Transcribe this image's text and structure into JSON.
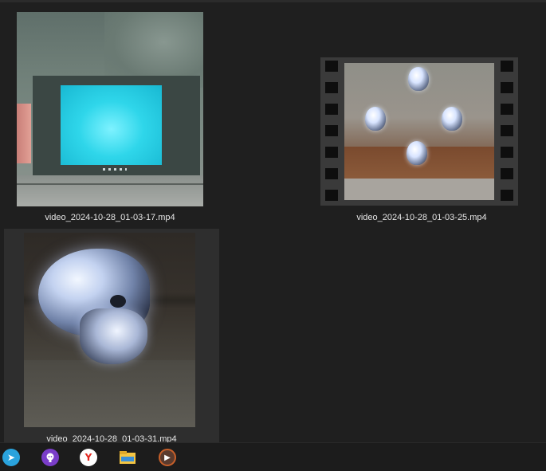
{
  "files": [
    {
      "name": "video_2024-10-28_01-03-17.mp4",
      "selected": false
    },
    {
      "name": "video_2024-10-28_01-03-25.mp4",
      "selected": false
    },
    {
      "name": "video_2024-10-28_01-03-31.mp4",
      "selected": true
    }
  ],
  "taskbar": {
    "apps": [
      {
        "icon": "telegram-icon"
      },
      {
        "icon": "github-icon"
      },
      {
        "icon": "yandex-browser-icon"
      },
      {
        "icon": "file-explorer-icon"
      },
      {
        "icon": "media-player-icon"
      }
    ],
    "glyphs": {
      "telegram": "➤",
      "yandex": "Y",
      "player": "▶"
    }
  },
  "colors": {
    "background": "#1f1f1f",
    "selection": "#2e2e2e",
    "caption_text": "#e6e6e6",
    "taskbar": "#1c1c1c"
  }
}
